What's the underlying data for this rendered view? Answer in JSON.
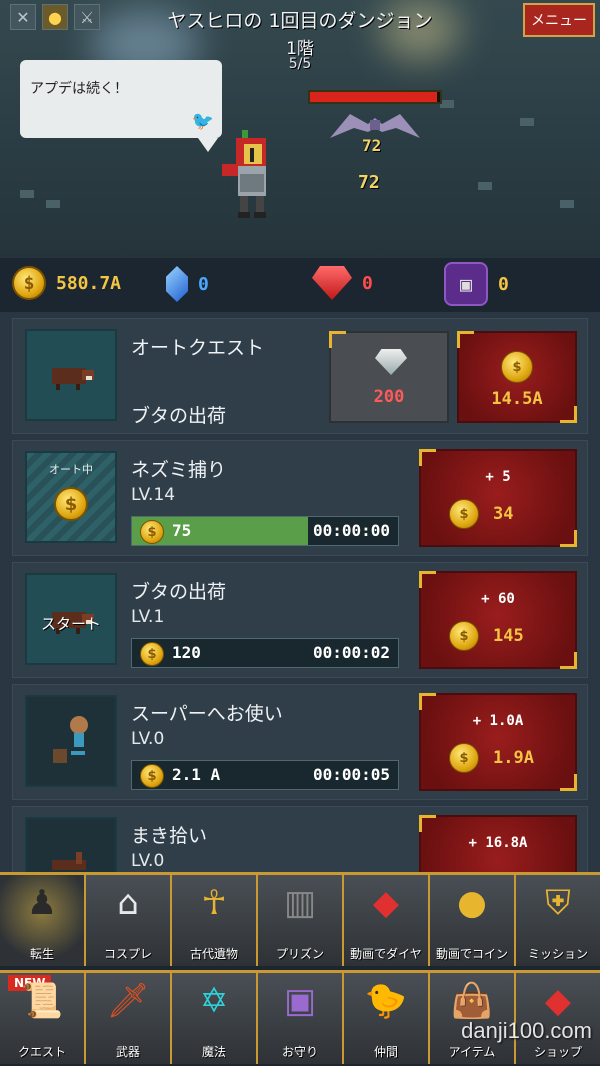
{
  "hud": {
    "title": "ヤスヒロの 1回目のダンジョン",
    "floor": "1階",
    "progress": "5/5",
    "menu_label": "メニュー",
    "speech": "アプデは続く！",
    "damage_values": [
      "72",
      "72"
    ],
    "enemy_hp_fraction": 0.98
  },
  "currency": {
    "gold": "580.7A",
    "blue_gem": "0",
    "red_gem": "0",
    "ticket": "0"
  },
  "auto_quest": {
    "name": "オートクエスト",
    "sub": "ブタの出荷",
    "diamond_cost": "200",
    "coin_value": "14.5A"
  },
  "quests": [
    {
      "name": "ネズミ捕り",
      "level": "LV.14",
      "thumb_label": "オート中",
      "bar_value": "75",
      "time": "00:00:00",
      "fill": 0.66,
      "plus": "+ 5",
      "reward": "34"
    },
    {
      "name": "ブタの出荷",
      "level": "LV.1",
      "thumb_overlay": "スタート",
      "bar_value": "120",
      "time": "00:00:02",
      "fill": 0,
      "plus": "+ 60",
      "reward": "145"
    },
    {
      "name": "スーパーへお使い",
      "level": "LV.0",
      "bar_value": "2.1  A",
      "time": "00:00:05",
      "fill": 0,
      "plus": "+ 1.0A",
      "reward": "1.9A"
    },
    {
      "name": "まき拾い",
      "level": "LV.0",
      "plus": "+ 16.8A"
    }
  ],
  "menu_row1": [
    "転生",
    "コスプレ",
    "古代遺物",
    "プリズン",
    "動画でダイヤ",
    "動画でコイン",
    "ミッション"
  ],
  "menu_row2": [
    "クエスト",
    "武器",
    "魔法",
    "お守り",
    "仲間",
    "アイテム",
    "ショップ"
  ],
  "new_badge": "NEW",
  "watermark": "danji100.com",
  "colors": {
    "accent_red": "#a8261e",
    "gold": "#f4c542",
    "frame_gold": "#c99a32",
    "progress_green": "#5a9e4a"
  }
}
